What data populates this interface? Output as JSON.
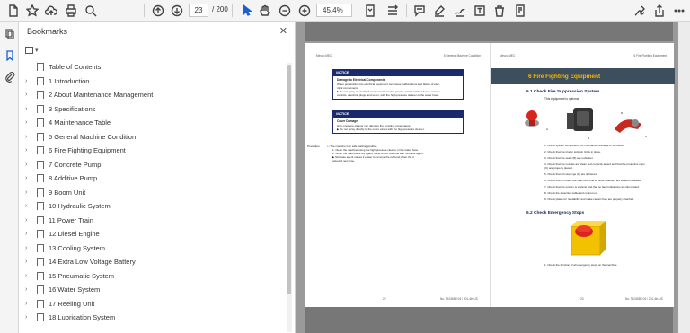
{
  "toolbar": {
    "page_current": "23",
    "page_total": "/ 200",
    "zoom": "45,4%"
  },
  "bookmarks_panel": {
    "title": "Bookmarks",
    "close": "✕",
    "items": [
      {
        "label": "Table of Contents",
        "expandable": false
      },
      {
        "label": "1 Introduction",
        "expandable": true
      },
      {
        "label": "2 About Maintenance Management",
        "expandable": true
      },
      {
        "label": "3 Specifications",
        "expandable": true
      },
      {
        "label": "4 Maintenance Table",
        "expandable": true
      },
      {
        "label": "5 General Machine Condition",
        "expandable": true
      },
      {
        "label": "6 Fire Fighting Equipment",
        "expandable": true
      },
      {
        "label": "7 Concrete Pump",
        "expandable": true
      },
      {
        "label": "8 Additive Pump",
        "expandable": true
      },
      {
        "label": "9 Boom Unit",
        "expandable": true
      },
      {
        "label": "10 Hydraulic System",
        "expandable": true
      },
      {
        "label": "11 Power Train",
        "expandable": true
      },
      {
        "label": "12 Diesel Engine",
        "expandable": true
      },
      {
        "label": "13 Cooling System",
        "expandable": true
      },
      {
        "label": "14 Extra Low Voltage Battery",
        "expandable": true
      },
      {
        "label": "15 Pneumatic System",
        "expandable": true
      },
      {
        "label": "16 Water System",
        "expandable": true
      },
      {
        "label": "17 Reeling Unit",
        "expandable": true
      },
      {
        "label": "18 Lubrication System",
        "expandable": true
      }
    ]
  },
  "left_page": {
    "header_left": "Meyco MEC",
    "header_right": "5 General Machine Condition",
    "notice1": {
      "tag": "NOTICE",
      "title": "Damage to Electrical Components",
      "lines": [
        "Water penetration into electrical equipment can cause malfunctions and failure of elec-",
        "trical components.",
        "▶ Do not spray to electrical components, control panels, control cabinet boxes, remote",
        "controls, electrical plugs, and so on, with the high-pressure cleaner or the water hose."
      ]
    },
    "notice2": {
      "tag": "NOTICE",
      "title": "Cover Damage",
      "lines": [
        "High-pressure cleaner can damage the sensitive cover vanes.",
        "▶ Do not spray directly to the cover vanes with the high-pressure cleaner."
      ]
    },
    "procedure_label": "Procedure",
    "procedure": [
      "☐ The machine is in safe parking position.",
      "1.  Clean the machine using the high-pressure cleaner or the water hose.",
      "2.  When the machine is dry again, spray entire machine with nitrolase agent.",
      "    ▶ Nitrolase agent makes it easier to remove the rebound when the it",
      "       rebound next time."
    ],
    "footer_page": "22",
    "footer_doc": "No. T1036B2.04 / 201-4in US"
  },
  "right_page": {
    "header_left": "Meyco MEC",
    "header_right": "6 Fire Fighting Equipment",
    "section_title": "6  Fire Fighting Equipment",
    "sub1_title": "6.1   Check Fire Suppression System",
    "sub1_note": "This equipment is optional.",
    "fig1_labels": [
      "A",
      "B",
      "C",
      "D"
    ],
    "steps1": [
      "1.  Check system components for mechanical damage or corrosion.",
      "2.  Check that the trigger lock pin (A) is in place.",
      "3.  Check that the seals (B) are unbroken.",
      "4.  Check that the nozzles are clean and correctly aimed and that the protective caps",
      "     (C) are properly placed.",
      "5.  Check that all couplings (C) are tightened.",
      "6.  Check that all hoses are intact and that all hose retainers are locked or welded.",
      "7.  Check that the system is working and that no fault indications are illuminated.",
      "8.  Check the detection cable and control unit.",
      "9.  Check plates for readability and make certain they are properly attached."
    ],
    "sub2_title": "6.2   Check Emergency Stops",
    "steps2": [
      "1.  Check the function of all emergency stops on the machine."
    ],
    "footer_page": "23",
    "footer_doc": "No. T1036B2.04 / 201-4in US"
  },
  "colors": {
    "section_bar": "#3d4f5c",
    "section_text": "#f7b500",
    "notice_blue": "#1a2a6c",
    "active_icon": "#1a5fd6"
  }
}
